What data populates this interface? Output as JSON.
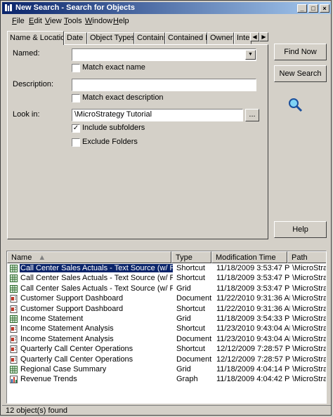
{
  "window": {
    "title": "New Search - Search for Objects"
  },
  "menu": [
    {
      "pre": "",
      "u": "F",
      "post": "ile"
    },
    {
      "pre": "",
      "u": "E",
      "post": "dit"
    },
    {
      "pre": "",
      "u": "V",
      "post": "iew"
    },
    {
      "pre": "",
      "u": "T",
      "post": "ools"
    },
    {
      "pre": "",
      "u": "W",
      "post": "indow"
    },
    {
      "pre": "",
      "u": "H",
      "post": "elp"
    }
  ],
  "tabs": [
    "Name & Location",
    "Date",
    "Object Types",
    "Contains",
    "Contained By",
    "Owner",
    "Inter"
  ],
  "form": {
    "named_label": "Named:",
    "named_value": "",
    "match_exact_name": "Match exact name",
    "description_label": "Description:",
    "description_value": "",
    "match_exact_description": "Match exact description",
    "lookin_label": "Look in:",
    "lookin_value": "\\MicroStrategy Tutorial",
    "browse_label": "...",
    "include_subfolders": "Include subfolders",
    "exclude_folders": "Exclude Folders"
  },
  "buttons": {
    "find_now": "Find Now",
    "new_search": "New Search",
    "help": "Help"
  },
  "columns": [
    "Name",
    "Type",
    "Modification Time",
    "Path"
  ],
  "results": [
    {
      "icon": "grid-icon",
      "name": "Call Center Sales Actuals - Text Source (w/ Prompt)",
      "type": "Shortcut",
      "time": "11/18/2009 3:53:47 PM",
      "path": "\\MicroStrateg",
      "selected": true
    },
    {
      "icon": "grid-icon",
      "name": "Call Center Sales Actuals - Text Source (w/ Prompt)",
      "type": "Shortcut",
      "time": "11/18/2009 3:53:47 PM",
      "path": "\\MicroStrateg"
    },
    {
      "icon": "grid-icon",
      "name": "Call Center Sales Actuals - Text Source (w/ Prompt)",
      "type": "Grid",
      "time": "11/18/2009 3:53:47 PM",
      "path": "\\MicroStrateg"
    },
    {
      "icon": "document-icon",
      "name": "Customer Support Dashboard",
      "type": "Document",
      "time": "11/22/2010 9:31:36 AM",
      "path": "\\MicroStrateg"
    },
    {
      "icon": "document-icon",
      "name": "Customer Support Dashboard",
      "type": "Shortcut",
      "time": "11/22/2010 9:31:36 AM",
      "path": "\\MicroStrateg"
    },
    {
      "icon": "grid-icon",
      "name": "Income Statement",
      "type": "Grid",
      "time": "11/18/2009 3:54:33 PM",
      "path": "\\MicroStrateg"
    },
    {
      "icon": "document-icon",
      "name": "Income Statement Analysis",
      "type": "Shortcut",
      "time": "11/23/2010 9:43:04 AM",
      "path": "\\MicroStrateg"
    },
    {
      "icon": "document-icon",
      "name": "Income Statement Analysis",
      "type": "Document",
      "time": "11/23/2010 9:43:04 AM",
      "path": "\\MicroStrateg"
    },
    {
      "icon": "document-icon",
      "name": "Quarterly Call Center Operations",
      "type": "Shortcut",
      "time": "12/12/2009 7:28:57 PM",
      "path": "\\MicroStrateg"
    },
    {
      "icon": "document-icon",
      "name": "Quarterly Call Center Operations",
      "type": "Document",
      "time": "12/12/2009 7:28:57 PM",
      "path": "\\MicroStrateg"
    },
    {
      "icon": "grid-icon",
      "name": "Regional Case Summary",
      "type": "Grid",
      "time": "11/18/2009 4:04:14 PM",
      "path": "\\MicroStrateg"
    },
    {
      "icon": "graph-icon",
      "name": "Revenue Trends",
      "type": "Graph",
      "time": "11/18/2009 4:04:42 PM",
      "path": "\\MicroStrateg"
    }
  ],
  "status": "12 object(s) found"
}
